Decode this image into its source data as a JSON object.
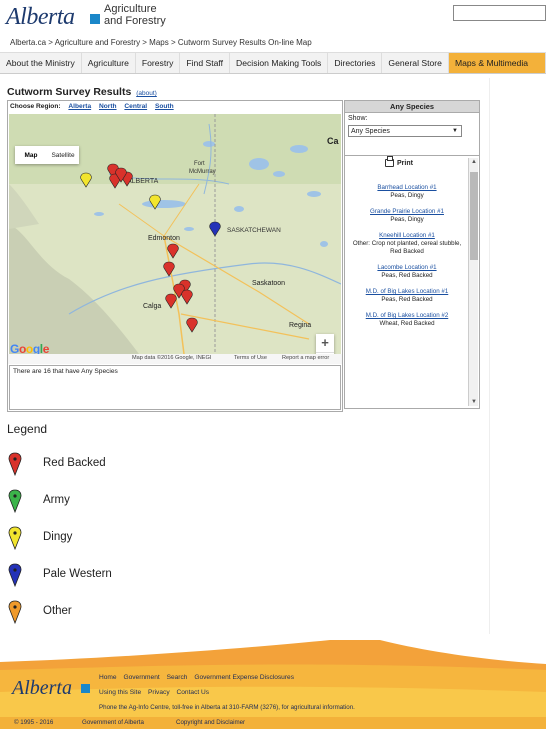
{
  "header": {
    "logo": "Alberta",
    "agency_line1": "Agriculture",
    "agency_line2": "and Forestry",
    "breadcrumb": "Alberta.ca > Agriculture and Forestry > Maps > Cutworm Survey Results On-line Map"
  },
  "nav": {
    "items": [
      "About the Ministry",
      "Agriculture",
      "Forestry",
      "Find Staff",
      "Decision Making Tools",
      "Directories",
      "General Store",
      "Maps & Multimedia"
    ],
    "active": "Maps & Multimedia"
  },
  "page": {
    "title": "Cutworm Survey Results",
    "about_link": "(about)",
    "choose_region_label": "Choose Region:",
    "regions": [
      "Alberta",
      "North",
      "Central",
      "South"
    ]
  },
  "map": {
    "type_map": "Map",
    "type_satellite": "Satellite",
    "place_labels": {
      "alberta": "ALBERTA",
      "fort_mcmurray_1": "Fort",
      "fort_mcmurray_2": "McMurray",
      "edmonton": "Edmonton",
      "saskatchewan": "SASKATCHEWAN",
      "saskatoon": "Saskatoon",
      "calgary": "Calga",
      "regina": "Regina",
      "can": "Ca"
    },
    "zoom_in": "+",
    "zoom_out": "−",
    "google_logo": "Google",
    "attribution_data": "Map data ©2016 Google, INEGI",
    "attribution_terms": "Terms of Use",
    "attribution_report": "Report a map error",
    "result_text": "There are 16 that have Any Species"
  },
  "panel": {
    "header": "Any Species",
    "show_label": "Show:",
    "select_value": "Any Species",
    "print_label": "Print",
    "entries": [
      {
        "location": "Barrhead Location #1",
        "detail": "Peas, Dingy"
      },
      {
        "location": "Grande Prairie Location #1",
        "detail": "Peas, Dingy"
      },
      {
        "location": "Kneehill Location #1",
        "detail": "Other: Crop not planted, cereal stubble, Red Backed"
      },
      {
        "location": "Lacombe Location #1",
        "detail": "Peas, Red Backed"
      },
      {
        "location": "M.D. of Big Lakes Location #1",
        "detail": "Peas, Red Backed"
      },
      {
        "location": "M.D. of Big Lakes Location #2",
        "detail": "Wheat, Red Backed"
      }
    ]
  },
  "legend": {
    "title": "Legend",
    "items": [
      {
        "label": "Red Backed",
        "color": "#d9322b"
      },
      {
        "label": "Army",
        "color": "#3bb44a"
      },
      {
        "label": "Dingy",
        "color": "#f2e52e"
      },
      {
        "label": "Pale Western",
        "color": "#2432b8"
      },
      {
        "label": "Other",
        "color": "#ef9a2b"
      }
    ]
  },
  "footer": {
    "logo": "Alberta",
    "links_row1": [
      "Home",
      "Government",
      "Search",
      "Government Expense Disclosures"
    ],
    "links_row2": [
      "Using this Site",
      "Privacy",
      "Contact Us"
    ],
    "phone": "Phone the Ag-Info Centre, toll-free in Alberta at 310-FARM (3276), for agricultural information.",
    "copyright": "© 1995 - 2016",
    "gov": "Government of Alberta",
    "disclaimer": "Copyright and Disclaimer"
  },
  "colors": {
    "accent": "#f3b13a",
    "link": "#1a4fa0",
    "brand": "#1d3a6e"
  }
}
